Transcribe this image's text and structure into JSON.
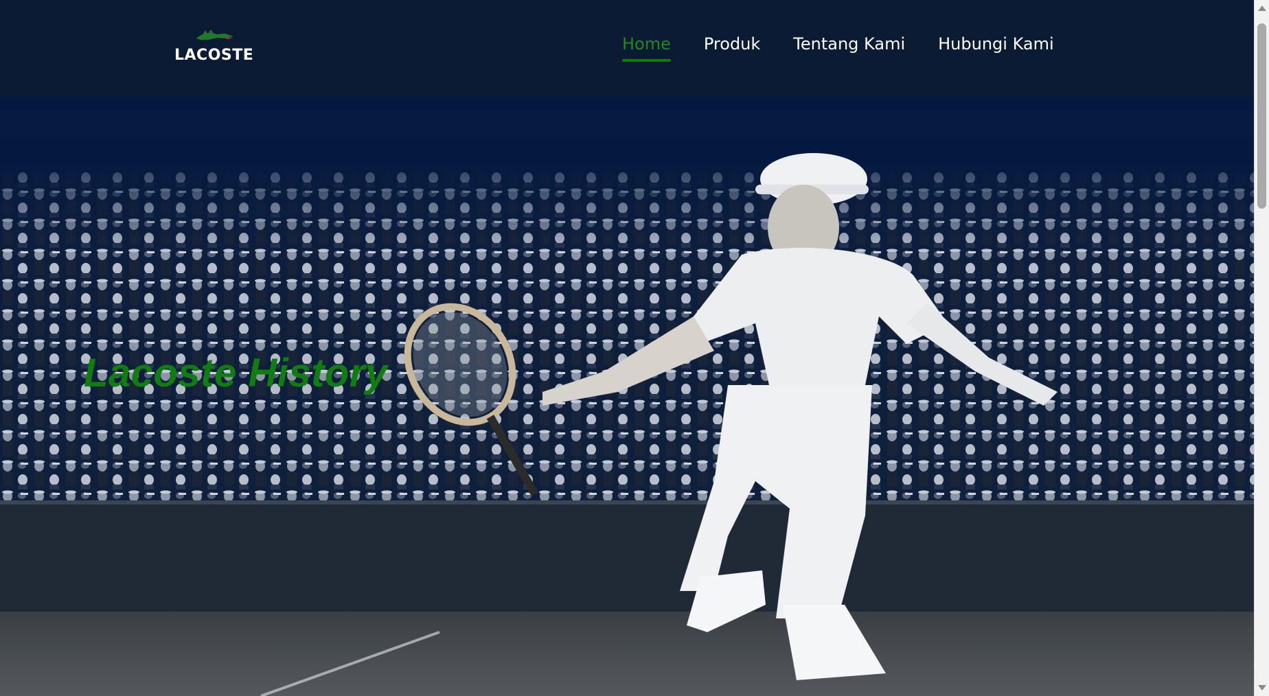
{
  "header": {
    "logo_text": "LACOSTE",
    "logo_icon": "crocodile-logo-icon",
    "nav": [
      {
        "label": "Home",
        "active": true
      },
      {
        "label": "Produk",
        "active": false
      },
      {
        "label": "Tentang Kami",
        "active": false
      },
      {
        "label": "Hubungi Kami",
        "active": false
      }
    ]
  },
  "hero": {
    "title": "Lacoste History",
    "image": "vintage-tennis-player-photo"
  },
  "colors": {
    "nav_bg": "#0b1b33",
    "accent_green": "#0f7d0f",
    "nav_text": "#ffffff"
  }
}
